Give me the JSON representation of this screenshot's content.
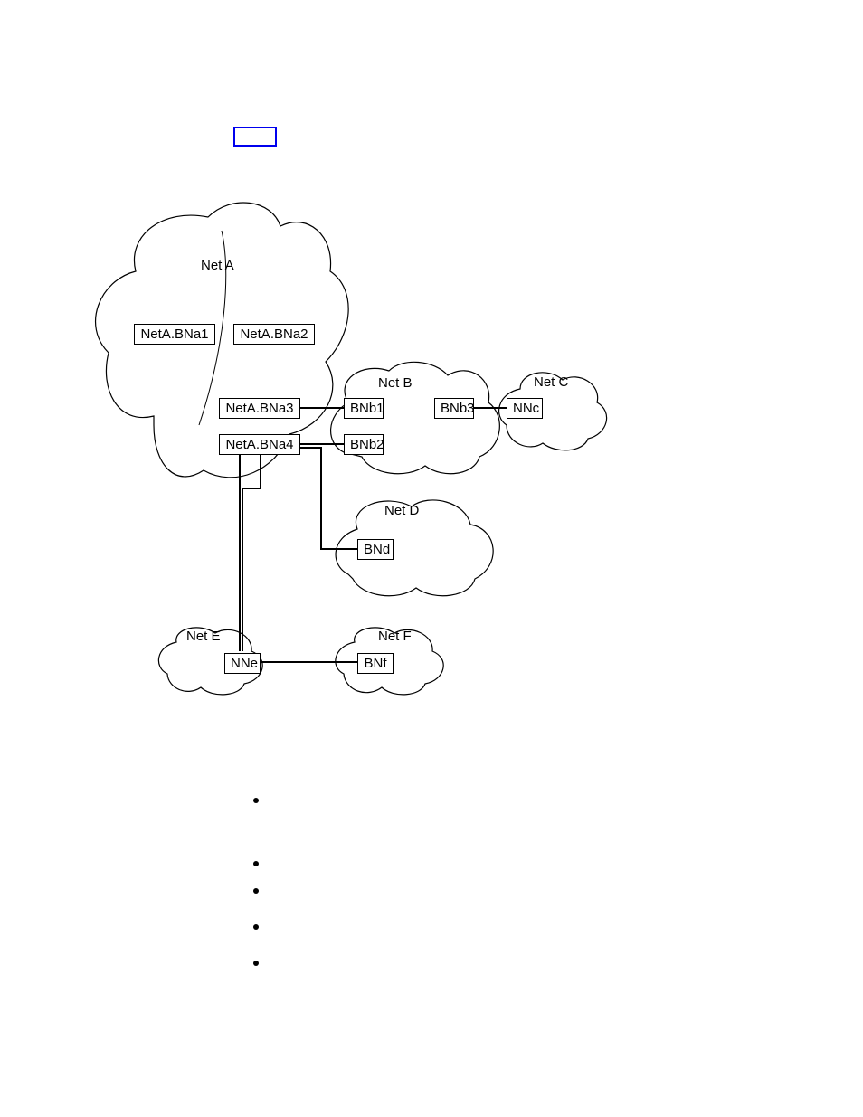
{
  "link_box": {
    "present": true
  },
  "networks": {
    "A": "Net A",
    "B": "Net B",
    "C": "Net C",
    "D": "Net D",
    "E": "Net E",
    "F": "Net F"
  },
  "nodes": {
    "neta_bna1": "NetA.BNa1",
    "neta_bna2": "NetA.BNa2",
    "neta_bna3": "NetA.BNa3",
    "neta_bna4": "NetA.BNa4",
    "bnb1": "BNb1",
    "bnb2": "BNb2",
    "bnb3": "BNb3",
    "nnc": "NNc",
    "bnd": "BNd",
    "nne": "NNe",
    "bnf": "BNf"
  },
  "connections": [
    [
      "NetA.BNa3",
      "BNb1"
    ],
    [
      "NetA.BNa4",
      "BNb2"
    ],
    [
      "NetA.BNa4",
      "BNd"
    ],
    [
      "NetA.BNa4",
      "NNe"
    ],
    [
      "BNb3",
      "NNc"
    ],
    [
      "NNe",
      "BNf"
    ]
  ],
  "bullets_count": 5
}
